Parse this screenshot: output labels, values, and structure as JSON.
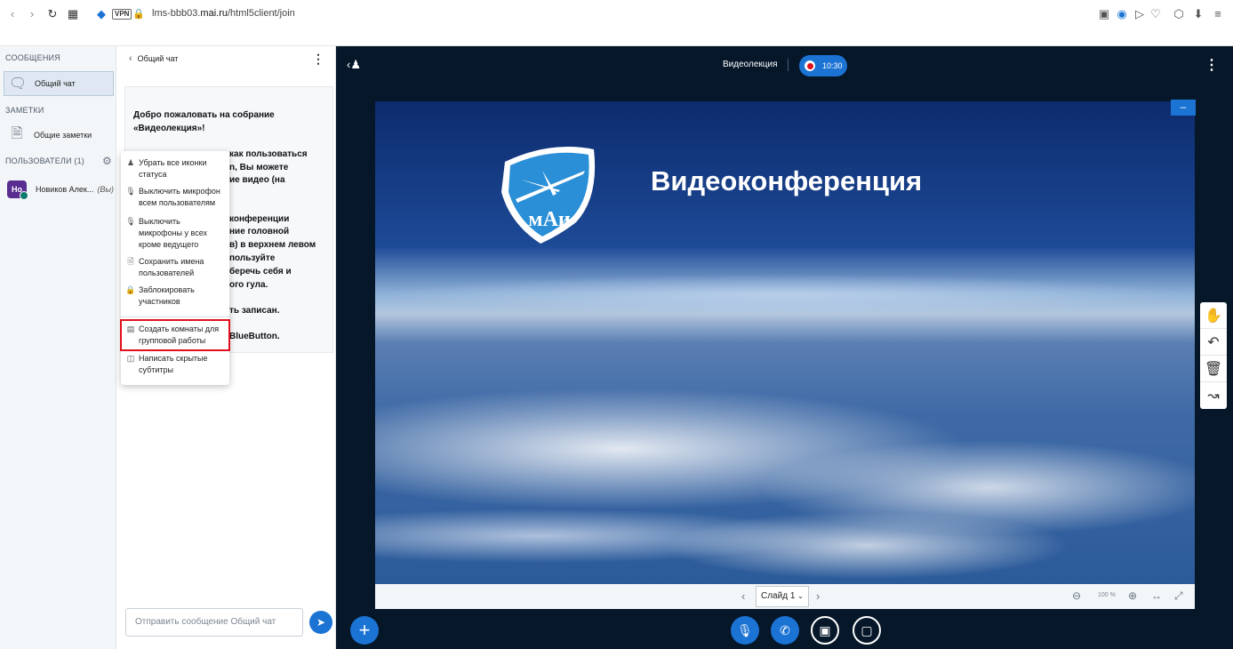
{
  "browser": {
    "url_prefix": "lms-bbb03.",
    "url_domain": "mai.ru",
    "url_path": "/html5client/join",
    "vpn_label": "VPN"
  },
  "sidebar": {
    "messages_title": "СООБЩЕНИЯ",
    "public_chat": "Общий чат",
    "notes_title": "ЗАМЕТКИ",
    "shared_notes": "Общие заметки",
    "users_title": "ПОЛЬЗОВАТЕЛИ (1)",
    "user": {
      "initials": "Но",
      "name": "Новиков Алек...",
      "you": "(Вы)"
    }
  },
  "chat": {
    "header": "Общий чат",
    "welcome_lines": [
      "Добро пожаловать на собрание",
      "«Видеолекция»!",
      "как пользоваться",
      "n, Вы можете",
      "ие видео (на",
      "конференции",
      "ние головной",
      "в) в верхнем левом",
      "пользуйте",
      "беречь себя и",
      "ого гула.",
      "ть записан.",
      "BlueButton."
    ],
    "input_placeholder": "Отправить сообщение Общий чат"
  },
  "menu": {
    "items": [
      "Убрать все иконки\nстатуса",
      "Выключить микрофон\nвсем пользователям",
      "Выключить\nмикрофоны у всех\nкроме ведущего",
      "Сохранить имена\nпользователей",
      "Заблокировать\nучастников",
      "Создать комнаты для\nгрупповой работы",
      "Написать скрытые\nсубтитры"
    ]
  },
  "main": {
    "session_title": "Видеолекция",
    "recording_time": "10:30",
    "slide_title": "Видеоконференция",
    "logo_text": "мАи",
    "slide_select": "Слайд 1",
    "zoom": "100 %"
  },
  "colors": {
    "accent": "#1b73d3",
    "dark_bg": "#06172a",
    "highlight": "#e0101c"
  }
}
